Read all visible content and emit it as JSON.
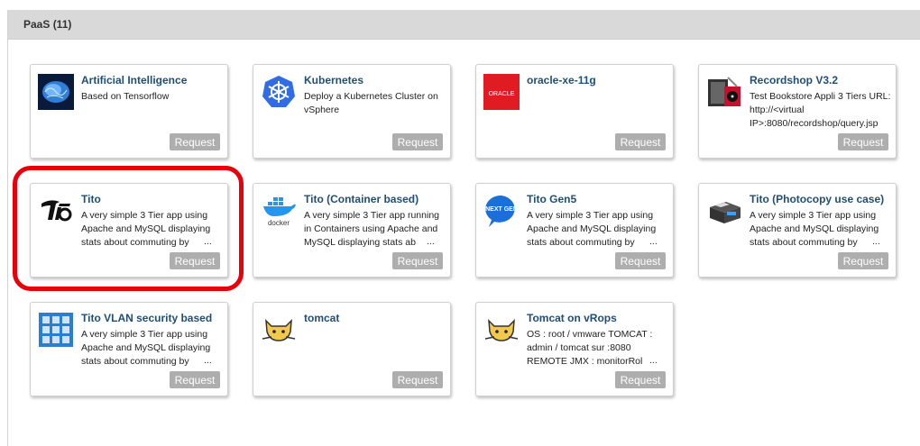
{
  "section": {
    "title": "PaaS (11)"
  },
  "request_label": "Request",
  "ellipsis": "...",
  "cards": [
    {
      "title": "Artificial Intelligence",
      "desc": "Based on Tensorflow",
      "icon": "brain-icon"
    },
    {
      "title": "Kubernetes",
      "desc": "Deploy a Kubernetes Cluster on vSphere",
      "icon": "kubernetes-icon"
    },
    {
      "title": "oracle-xe-11g",
      "desc": "",
      "icon": "oracle-icon",
      "icon_text": "ORACLE"
    },
    {
      "title": "Recordshop V3.2",
      "desc": "Test Bookstore Appli 3 Tiers URL: http://<virtual IP>:8080/recordshop/query.jsp",
      "icon": "recordshop-icon"
    },
    {
      "title": "Tito",
      "desc": "A very simple 3 Tier app using Apache and MySQL displaying stats about commuting by",
      "icon": "tito-icon"
    },
    {
      "title": "Tito (Container based)",
      "desc": "A very simple 3 Tier app running in Containers using Apache and MySQL displaying stats ab",
      "icon": "docker-icon",
      "icon_text": "docker"
    },
    {
      "title": "Tito Gen5",
      "desc": "A very simple 3 Tier app using Apache and MySQL displaying stats about commuting by",
      "icon": "next-gen-icon",
      "icon_text": "NEXT GEN"
    },
    {
      "title": "Tito (Photocopy use case)",
      "desc": "A very simple 3 Tier app using Apache and MySQL displaying stats about commuting by",
      "icon": "photocopier-icon"
    },
    {
      "title": "Tito VLAN security based",
      "desc": "A very simple 3 Tier app using Apache and MySQL displaying stats about commuting by",
      "icon": "vlan-icon"
    },
    {
      "title": "tomcat",
      "desc": "",
      "icon": "tomcat-icon"
    },
    {
      "title": "Tomcat on vRops",
      "desc": "OS : root / vmware TOMCAT : admin / tomcat sur :8080 REMOTE JMX : monitorRol",
      "icon": "tomcat-icon"
    }
  ],
  "colors": {
    "title": "#1f4e79",
    "request_bg": "#aeaeae",
    "highlight": "#e8000b",
    "header_bg": "#d9d9d9"
  }
}
